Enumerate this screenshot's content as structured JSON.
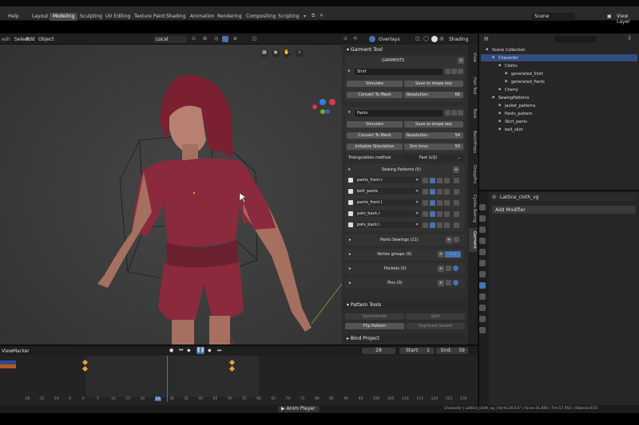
{
  "top_menu": [
    "Help"
  ],
  "workspaces": [
    "Layout",
    "Modeling",
    "Sculpting",
    "UV Editing",
    "Texture Paint",
    "Shading",
    "Animation",
    "Rendering",
    "Compositing",
    "Scripting"
  ],
  "active_workspace": "Modeling",
  "scene_label": "Scene",
  "view_layer_label": "View Layer",
  "viewport_header": {
    "menus": [
      "Select",
      "Add",
      "Object"
    ],
    "transform": "Local",
    "overlays": "Overlays",
    "shading": "Shading",
    "left_fragment": "esh"
  },
  "object_label": "cloth_vg",
  "garment_tool": {
    "title": "Garment Tool",
    "garments_label": "GARMENTS",
    "shirt": {
      "name": "Shirt",
      "simulate": "Simulate",
      "save": "Save to shape key",
      "convert": "Convert To Mesh",
      "res_label": "Resolution:",
      "res": "68"
    },
    "pants": {
      "name": "Pants",
      "simulate": "Simulate",
      "save": "Save to shape key",
      "convert": "Convert To Mesh",
      "res_label": "Resolution:",
      "res": "54",
      "init": "Initialize Simulation",
      "sim_label": "Sim time:",
      "sim": "50"
    },
    "triang_label": "Triangulation method",
    "triang_value": "Fast (LQ)",
    "patterns_title": "Sewing Patterns (5)",
    "patterns": [
      "pants_front.r",
      "belt_pants",
      "pants_front.l",
      "pats_back.r",
      "pats_back.l"
    ],
    "pants_sewings": "Pants Sewings (11)",
    "vertex_groups": "Vertex groups (0)",
    "pockets": "Pockets (0)",
    "pins": "Pins (0)"
  },
  "pattern_tools": {
    "title": "Pattern Tools",
    "symmetrize": "Symmetrize",
    "split": "Split",
    "flip": "Flip Pattern",
    "duplicate": "Duplicate Sewed"
  },
  "bind_project": "Bind Project",
  "sidebar_tabs": [
    "View",
    "Hair Tool",
    "Tools",
    "BatchProps",
    "GroupPro",
    "Cycles Baking",
    "Garment"
  ],
  "outliner": [
    {
      "label": "Scene Collection",
      "indent": 0
    },
    {
      "label": "Character",
      "indent": 1,
      "selected": true
    },
    {
      "label": "Cloths",
      "indent": 2
    },
    {
      "label": "generated_Shirt",
      "indent": 3
    },
    {
      "label": "generated_Pants",
      "indent": 3
    },
    {
      "label": "Cherry",
      "indent": 2
    },
    {
      "label": "SewingPatterns",
      "indent": 1
    },
    {
      "label": "jacket_patterns",
      "indent": 2
    },
    {
      "label": "Pants_pattern",
      "indent": 2
    },
    {
      "label": "Skirt_pants",
      "indent": 2
    },
    {
      "label": "belt_skirt",
      "indent": 2
    }
  ],
  "properties": {
    "object_name": "Lattice_cloth_vg",
    "add_modifier": "Add Modifier"
  },
  "timeline": {
    "menus": [
      "View",
      "Marker"
    ],
    "current": "28",
    "start_label": "Start:",
    "start": "1",
    "end_label": "End:",
    "end": "59",
    "ticks": [
      "-20",
      "-15",
      "-10",
      "-5",
      "0",
      "5",
      "10",
      "15",
      "20",
      "25",
      "30",
      "35",
      "40",
      "45",
      "50",
      "55",
      "60",
      "65",
      "70",
      "75",
      "80",
      "85",
      "90",
      "95",
      "100",
      "105",
      "110",
      "115",
      "120",
      "125",
      "130"
    ],
    "current_tick": "25"
  },
  "status": {
    "center": "Anim Player",
    "right": "Character | Lattice_cloth_vg | Verts:29,537 | Faces:31,893 | Tris:57,955 | Objects:0/15"
  },
  "colors": {
    "accent": "#4772b3",
    "keyframe": "#e4a33a",
    "garment": "#8a2a3c"
  }
}
